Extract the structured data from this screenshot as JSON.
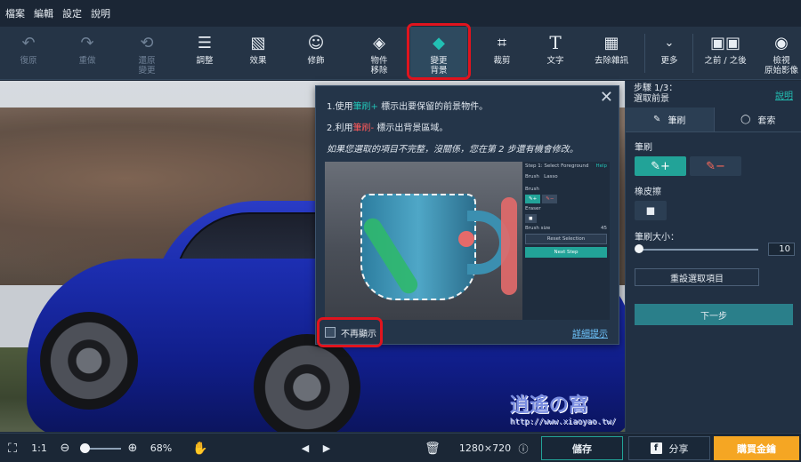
{
  "menu": [
    "檔案",
    "編輯",
    "設定",
    "說明"
  ],
  "toolbar": {
    "undo": "復原",
    "redo": "重做",
    "restore_l1": "還原",
    "restore_l2": "變更",
    "adjust": "調整",
    "effects": "效果",
    "retouch": "修飾",
    "object_l1": "物件",
    "object_l2": "移除",
    "bg_l1": "變更",
    "bg_l2": "背景",
    "crop": "裁剪",
    "text": "文字",
    "denoise": "去除雜訊",
    "more": "更多",
    "before_after": "之前 / 之後",
    "original_l1": "檢視",
    "original_l2": "原始影像"
  },
  "popup": {
    "line1_pre": "1.使用",
    "line1_brush": "筆刷+",
    "line1_post": " 標示出要保留的前景物件。",
    "line2_pre": "2.利用",
    "line2_brush": "筆刷-",
    "line2_post": " 標示出背景區域。",
    "line3": "如果您選取的項目不完整，沒關係，您在第 2 步還有機會修改。",
    "demo": {
      "step": "Step 1: Select Foreground",
      "help": "Help",
      "brush": "Brush",
      "lasso": "Lasso",
      "brush_label": "Brush",
      "eraser": "Eraser",
      "brush_size": "Brush size",
      "size_value": "45",
      "reset": "Reset Selection",
      "next": "Next Step"
    },
    "dont_show": "不再顯示",
    "details": "詳細提示"
  },
  "panel": {
    "step_l1": "步驟 1/3：",
    "step_l2": "選取前景",
    "help": "說明",
    "tab_brush": "筆刷",
    "tab_lasso": "套索",
    "brush_label": "筆刷",
    "eraser_label": "橡皮擦",
    "size_label": "筆刷大小：",
    "size_value": "10",
    "reset": "重設選取項目",
    "next": "下一步"
  },
  "bottom": {
    "ratio": "1:1",
    "zoom": "68%",
    "zoom_fraction": 0.1,
    "dims": "1280×720",
    "save": "儲存",
    "share": "分享",
    "buy": "購買金鑰"
  },
  "watermark": {
    "title": "逍遙の窩",
    "url": "http://www.xiaoyao.tw/"
  },
  "colors": {
    "accent": "#22c0b4",
    "highlight": "#e0141e",
    "buy": "#f5a623"
  }
}
